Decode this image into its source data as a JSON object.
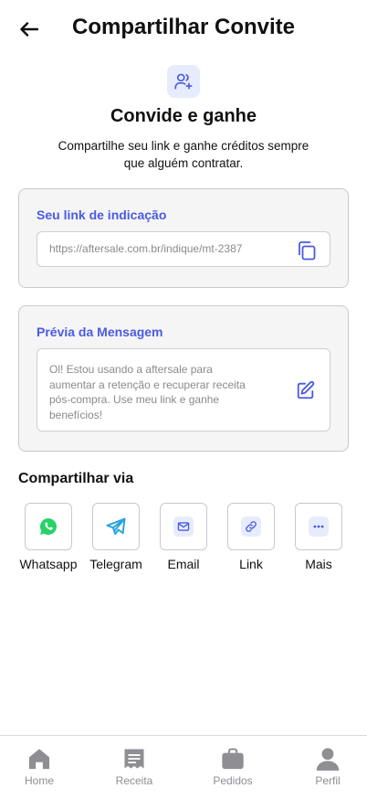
{
  "header": {
    "title": "Compartilhar Convite"
  },
  "hero": {
    "title": "Convide e ganhe",
    "subtitle": "Compartilhe seu link e ganhe créditos sempre que alguém contratar."
  },
  "referral": {
    "label": "Seu link de indicação",
    "link": "https://aftersale.com.br/indique/mt-2387"
  },
  "preview": {
    "label": "Prévia da Mensagem",
    "message": "Ol! Estou usando a aftersale para aumentar a retenção e recuperar receita pós-compra. Use meu link e ganhe benefícios!"
  },
  "share": {
    "title": "Compartilhar via",
    "options": [
      {
        "label": "Whatsapp",
        "icon": "whatsapp-icon",
        "color": "#25d366"
      },
      {
        "label": "Telegram",
        "icon": "telegram-icon",
        "color": "#2aa3e0"
      },
      {
        "label": "Email",
        "icon": "mail-icon",
        "color": "#4a5be0"
      },
      {
        "label": "Link",
        "icon": "link-icon",
        "color": "#4a5be0"
      },
      {
        "label": "Mais",
        "icon": "more-icon",
        "color": "#4a5be0"
      }
    ]
  },
  "nav": {
    "items": [
      {
        "label": "Home",
        "icon": "home-icon"
      },
      {
        "label": "Receita",
        "icon": "receipt-icon"
      },
      {
        "label": "Pedidos",
        "icon": "bag-icon"
      },
      {
        "label": "Perfil",
        "icon": "user-icon"
      }
    ]
  },
  "colors": {
    "accent": "#4a5be0",
    "card_bg": "#f5f5f5",
    "icon_bg": "#e7ecfc",
    "nav_inactive": "#8e8e93"
  }
}
